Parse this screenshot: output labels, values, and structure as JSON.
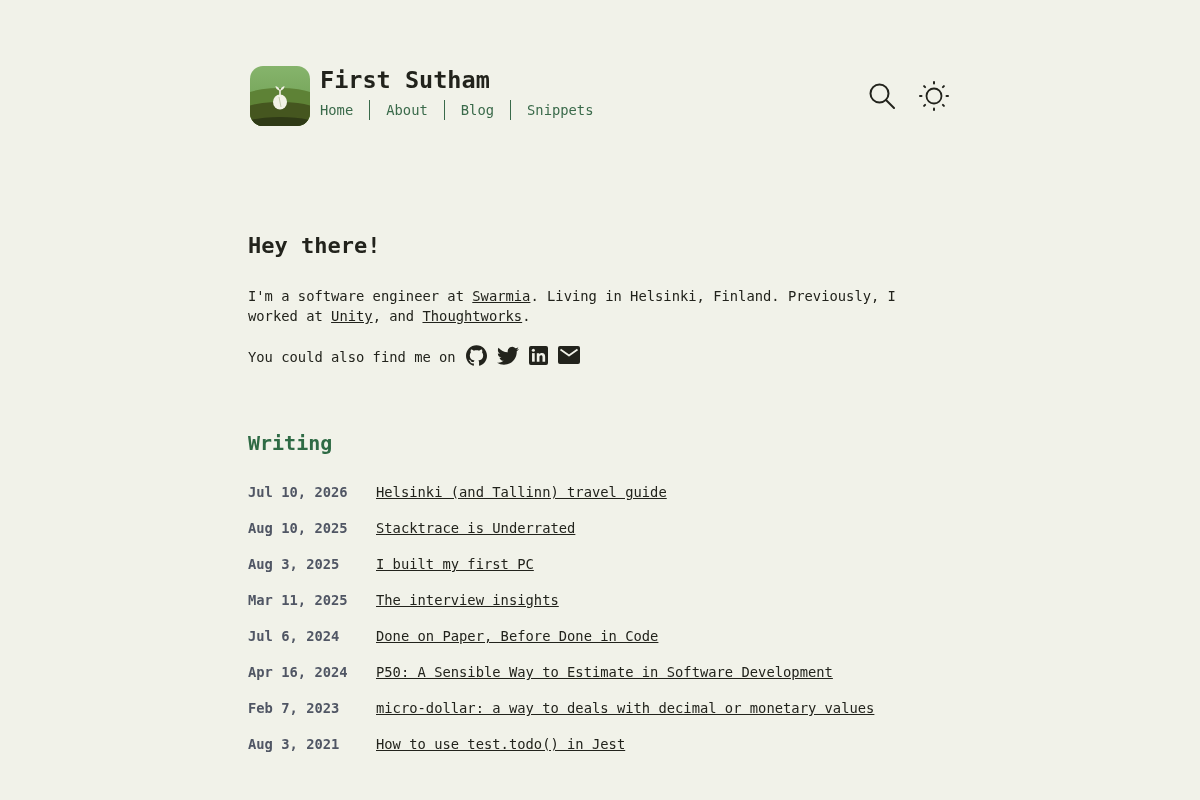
{
  "site": {
    "title": "First Sutham",
    "nav": [
      {
        "label": "Home"
      },
      {
        "label": "About"
      },
      {
        "label": "Blog"
      },
      {
        "label": "Snippets"
      }
    ]
  },
  "intro": {
    "heading": "Hey there!",
    "paragraph": [
      {
        "kind": "text",
        "text": "I'm a software engineer at "
      },
      {
        "kind": "link",
        "text": "Swarmia"
      },
      {
        "kind": "text",
        "text": ". Living in Helsinki, Finland. Previously, I worked at "
      },
      {
        "kind": "link",
        "text": "Unity"
      },
      {
        "kind": "text",
        "text": ", and "
      },
      {
        "kind": "link",
        "text": "Thoughtworks"
      },
      {
        "kind": "text",
        "text": "."
      }
    ],
    "social_caption": "You could also find me on"
  },
  "writing": {
    "heading": "Writing",
    "posts": [
      {
        "date": "Jul 10, 2026",
        "title": "Helsinki (and Tallinn) travel guide"
      },
      {
        "date": "Aug 10, 2025",
        "title": "Stacktrace is Underrated"
      },
      {
        "date": "Aug 3, 2025",
        "title": "I built my first PC"
      },
      {
        "date": "Mar 11, 2025",
        "title": "The interview insights"
      },
      {
        "date": "Jul 6, 2024",
        "title": "Done on Paper, Before Done in Code"
      },
      {
        "date": "Apr 16, 2024",
        "title": "P50: A Sensible Way to Estimate in Software Development"
      },
      {
        "date": "Feb 7, 2023",
        "title": "micro-dollar: a way to deals with decimal or monetary values"
      },
      {
        "date": "Aug 3, 2021",
        "title": "How to use test.todo() in Jest"
      }
    ]
  }
}
